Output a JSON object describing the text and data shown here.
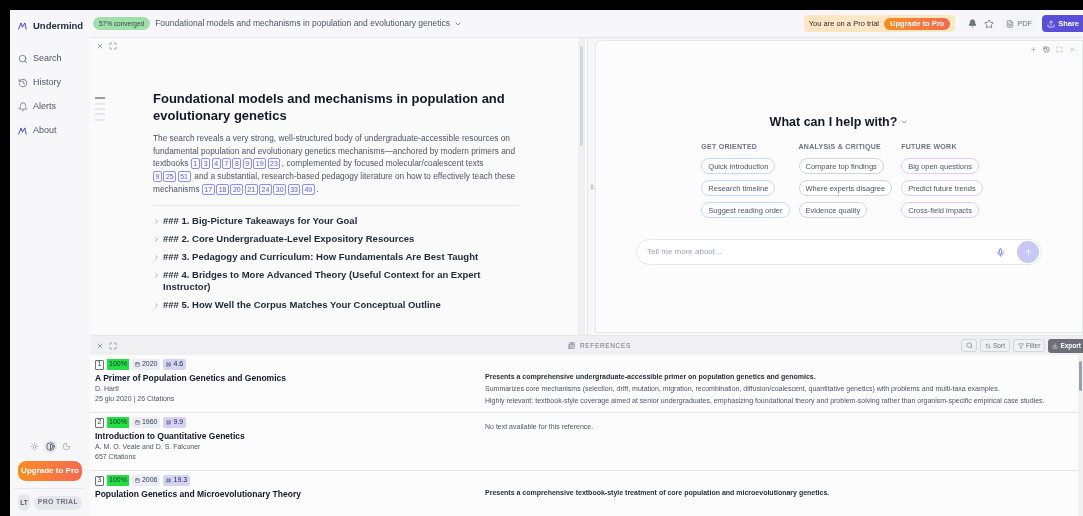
{
  "sidebar": {
    "brand": "Undermind",
    "items": [
      {
        "kind": "search",
        "label": "Search"
      },
      {
        "kind": "history",
        "label": "History"
      },
      {
        "kind": "alerts",
        "label": "Alerts"
      },
      {
        "kind": "about",
        "label": "About"
      }
    ],
    "theme_options": [
      {
        "kind": "light",
        "selected": false
      },
      {
        "kind": "system",
        "selected": true
      },
      {
        "kind": "dark",
        "selected": false
      }
    ],
    "upgrade_button": "Upgrade to Pro",
    "avatar": "LT",
    "plan_badge": "PRO TRIAL"
  },
  "header": {
    "status_badge": "57% converged",
    "title": "Foundational models and mechanisms in population and evolutionary genetics",
    "trial_notice": "You are on a Pro trial",
    "upgrade_button": "Upgrade to Pro",
    "pdf_button": "PDF",
    "share_button": "Share"
  },
  "report": {
    "title": "Foundational models and mechanisms in population and evolutionary genetics",
    "summary": [
      {
        "kind": "text",
        "text": "The search reveals a very strong, well-structured body of undergraduate-accessible resources on fundamental population and evolutionary genetics mechanisms—anchored by modern primers and textbooks "
      },
      {
        "kind": "citations",
        "refs": [
          "1",
          "3",
          "4",
          "7",
          "8",
          "9",
          "19",
          "23"
        ]
      },
      {
        "kind": "text",
        "text": ", complemented by focused molecular/coalescent texts "
      },
      {
        "kind": "citations",
        "refs": [
          "9",
          "25",
          "51"
        ]
      },
      {
        "kind": "text",
        "text": " and a substantial, research-based pedagogy literature on how to effectively teach these mechanisms "
      },
      {
        "kind": "citations",
        "refs": [
          "17",
          "18",
          "20",
          "21",
          "24",
          "30",
          "33",
          "49"
        ]
      },
      {
        "kind": "text",
        "text": "."
      }
    ],
    "sections": [
      {
        "title": "### 1. Big-Picture Takeaways for Your Goal",
        "expanded": false
      },
      {
        "title": "### 2. Core Undergraduate-Level Expository Resources",
        "expanded": false
      },
      {
        "title": "### 3. Pedagogy and Curriculum: How Fundamentals Are Best Taught",
        "expanded": false
      },
      {
        "title": "### 4. Bridges to More Advanced Theory (Useful Context for an Expert Instructor)",
        "expanded": false
      },
      {
        "title": "### 5. How Well the Corpus Matches Your Conceptual Outline",
        "expanded": false
      }
    ]
  },
  "chat": {
    "heading": "What can I help with?",
    "groups": [
      {
        "title": "GET ORIENTED",
        "color": "#bfdbfe",
        "prompts": [
          "Quick introduction",
          "Research timeline",
          "Suggest reading order"
        ]
      },
      {
        "title": "ANALYSIS & CRITIQUE",
        "color": "#d1d5db",
        "prompts": [
          "Compare top findings",
          "Where experts disagree",
          "Evidence quality"
        ]
      },
      {
        "title": "FUTURE WORK",
        "color": "#e9c6f5",
        "prompts": [
          "Big open questions",
          "Predict future trends",
          "Cross-field impacts"
        ]
      }
    ],
    "input": {
      "placeholder": "Tell me more about..."
    },
    "send_disabled": true
  },
  "references": {
    "label": "REFERENCES",
    "sort_button": "Sort",
    "filter_button": "Filter",
    "export_button": "Export",
    "rows": [
      {
        "index": "1",
        "relevance": "100%",
        "year": "2020",
        "score": "4.6",
        "title": "A Primer of Population Genetics and Genomics",
        "authors": "D. Hartl",
        "meta": "25 giu 2020 | 26 Citations",
        "summary": "Presents a comprehensive undergraduate-accessible primer on population genetics and genomics.",
        "details": [
          "Summarizes core mechanisms (selection, drift, mutation, migration, recombination, diffusion/coalescent, quantitative genetics) with problems and multi-taxa examples.",
          "Highly relevant: textbook-style coverage aimed at senior undergraduates, emphasizing foundational theory and problem-solving rather than organism-specific empirical case studies."
        ]
      },
      {
        "index": "2",
        "relevance": "100%",
        "year": "1960",
        "score": "9.9",
        "title": "Introduction to Quantitative Genetics",
        "authors": "A. M. O. Veale and D. S. Falconer",
        "meta": "657 Citations",
        "note": "No text available for this reference."
      },
      {
        "index": "3",
        "relevance": "100%",
        "year": "2006",
        "score": "19.3",
        "title": "Population Genetics and Microevolutionary Theory",
        "summary": "Presents a comprehensive textbook-style treatment of core population and microevolutionary genetics."
      }
    ]
  }
}
